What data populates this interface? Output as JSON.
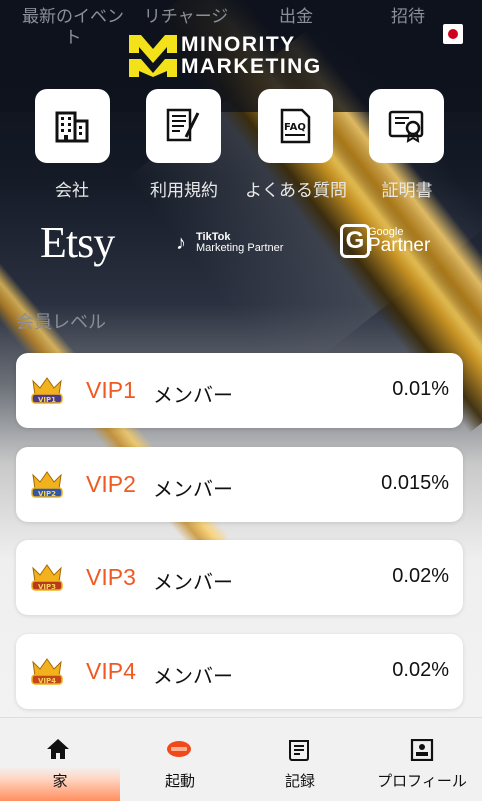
{
  "top_nav": {
    "items": [
      {
        "label": "最新のイベント"
      },
      {
        "label": "リチャージ"
      },
      {
        "label": "出金"
      },
      {
        "label": "招待"
      }
    ],
    "language_flag": "japan-flag-icon"
  },
  "logo": {
    "line1": "MINORITY",
    "line2": "MARKETING",
    "mark_color": "#f3e21a"
  },
  "quick_links": [
    {
      "label": "会社",
      "icon": "building-icon"
    },
    {
      "label": "利用規約",
      "icon": "document-icon"
    },
    {
      "label": "よくある質問",
      "icon": "faq-icon"
    },
    {
      "label": "証明書",
      "icon": "certificate-icon"
    }
  ],
  "partners": {
    "etsy": "Etsy",
    "tiktok_line1": "TikTok",
    "tiktok_line2": "Marketing Partner",
    "google_small": "Google",
    "google_big": "Partner"
  },
  "member_levels": {
    "title": "会員レベル",
    "items": [
      {
        "level": "VIP1",
        "member": "メンバー",
        "rate": "0.01%"
      },
      {
        "level": "VIP2",
        "member": "メンバー",
        "rate": "0.015%"
      },
      {
        "level": "VIP3",
        "member": "メンバー",
        "rate": "0.02%"
      },
      {
        "level": "VIP4",
        "member": "メンバー",
        "rate": "0.02%"
      }
    ]
  },
  "tabbar": {
    "items": [
      {
        "label": "家",
        "icon": "home-icon",
        "active": true
      },
      {
        "label": "起動",
        "icon": "launch-icon",
        "active": false
      },
      {
        "label": "記録",
        "icon": "records-icon",
        "active": false
      },
      {
        "label": "プロフィール",
        "icon": "profile-icon",
        "active": false
      }
    ]
  },
  "colors": {
    "accent": "#ef5a23",
    "gold": "#f3e21a",
    "active_tab": "#ff8c5a"
  }
}
